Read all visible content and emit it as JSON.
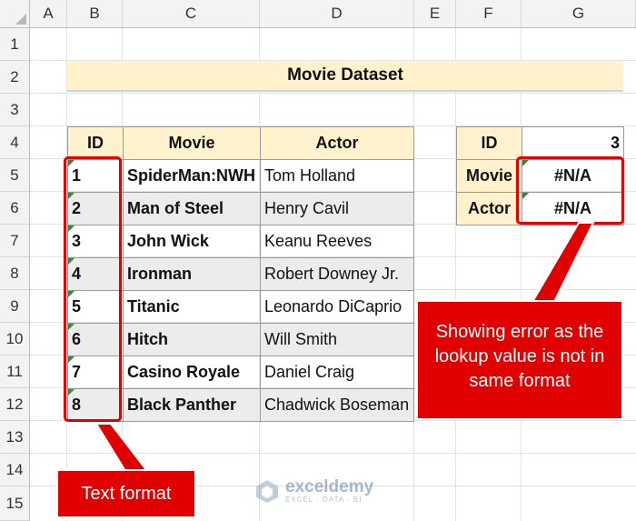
{
  "columns": [
    "A",
    "B",
    "C",
    "D",
    "E",
    "F",
    "G"
  ],
  "rows": [
    "1",
    "2",
    "3",
    "4",
    "5",
    "6",
    "7",
    "8",
    "9",
    "10",
    "11",
    "12",
    "13",
    "14",
    "15"
  ],
  "title": "Movie Dataset",
  "table": {
    "headers": [
      "ID",
      "Movie",
      "Actor"
    ],
    "rows": [
      {
        "id": "1",
        "movie": "SpiderMan:NWH",
        "actor": "Tom Holland"
      },
      {
        "id": "2",
        "movie": "Man of Steel",
        "actor": "Henry Cavil"
      },
      {
        "id": "3",
        "movie": "John Wick",
        "actor": "Keanu Reeves"
      },
      {
        "id": "4",
        "movie": "Ironman",
        "actor": "Robert Downey Jr."
      },
      {
        "id": "5",
        "movie": "Titanic",
        "actor": "Leonardo DiCaprio"
      },
      {
        "id": "6",
        "movie": "Hitch",
        "actor": "Will Smith"
      },
      {
        "id": "7",
        "movie": "Casino Royale",
        "actor": "Daniel Craig"
      },
      {
        "id": "8",
        "movie": "Black Panther",
        "actor": "Chadwick Boseman"
      }
    ]
  },
  "lookup": {
    "id_label": "ID",
    "id_value": "3",
    "movie_label": "Movie",
    "movie_value": "#N/A",
    "actor_label": "Actor",
    "actor_value": "#N/A"
  },
  "annotations": {
    "error_note": "Showing error as the lookup value is not in same format",
    "text_format_note": "Text format"
  },
  "watermark": {
    "name": "exceldemy",
    "tagline": "EXCEL · DATA · BI"
  },
  "colors": {
    "header_fill": "#fff2cc",
    "alt_row_fill": "#ececec",
    "annotation_red": "#e00000",
    "error_indicator": "#2e8b3a"
  }
}
